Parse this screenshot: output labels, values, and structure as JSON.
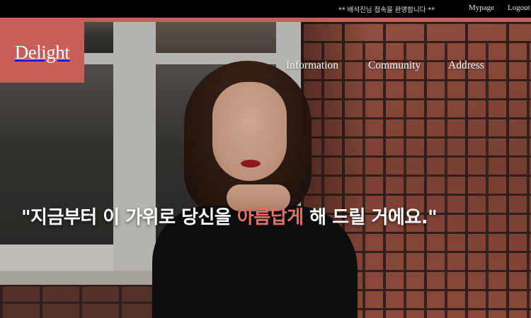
{
  "topbar": {
    "welcome": "** 배석진님 접속을 환영합니다 **",
    "mypage_label": "Mypage",
    "logout_label": "Logout"
  },
  "brand": {
    "logo_text": "Delight"
  },
  "nav": {
    "items": [
      {
        "label": "Information"
      },
      {
        "label": "Community"
      },
      {
        "label": "Address"
      }
    ]
  },
  "hero": {
    "headline_pre": "\"지금부터 이 가위로 당신을 ",
    "headline_accent": "아름답게",
    "headline_post": " 해 드릴 거에요.\""
  },
  "colors": {
    "accent": "#c85d5a",
    "topbar_bg": "#000000",
    "headline_accent": "#e0716c"
  }
}
